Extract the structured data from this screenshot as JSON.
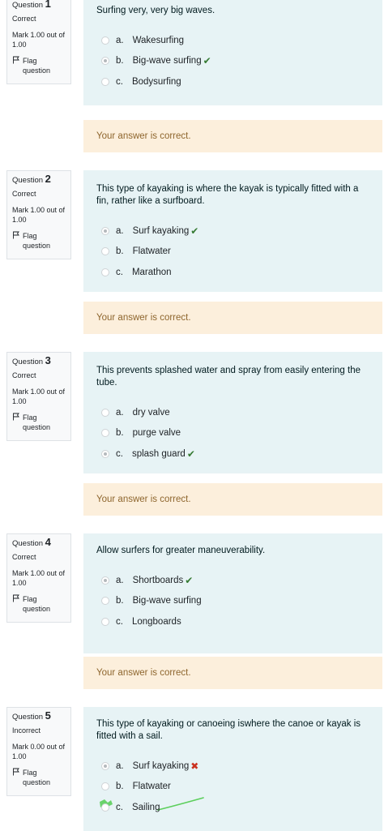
{
  "labels": {
    "question": "Question",
    "flag": "Flag question",
    "flag_line1": "Flag",
    "flag_line2": "question"
  },
  "questions": [
    {
      "number": "1",
      "state": "Correct",
      "mark_line1": "Mark 1.00 out of",
      "mark_line2": "1.00",
      "text": "Surfing very, very big waves.",
      "answers": [
        {
          "letter": "a.",
          "text": "Wakesurfing",
          "selected": false,
          "mark": ""
        },
        {
          "letter": "b.",
          "text": "Big-wave surfing",
          "selected": true,
          "mark": "correct"
        },
        {
          "letter": "c.",
          "text": "Bodysurfing",
          "selected": false,
          "mark": ""
        }
      ],
      "feedback": "Your answer is correct."
    },
    {
      "number": "2",
      "state": "Correct",
      "mark_line1": "Mark 1.00 out of",
      "mark_line2": "1.00",
      "text": "This type of kayaking is where the kayak is typically fitted with a fin, rather like a surfboard.",
      "answers": [
        {
          "letter": "a.",
          "text": "Surf kayaking",
          "selected": true,
          "mark": "correct"
        },
        {
          "letter": "b.",
          "text": "Flatwater",
          "selected": false,
          "mark": ""
        },
        {
          "letter": "c.",
          "text": "Marathon",
          "selected": false,
          "mark": ""
        }
      ],
      "feedback": "Your answer is correct."
    },
    {
      "number": "3",
      "state": "Correct",
      "mark_line1": "Mark 1.00 out of",
      "mark_line2": "1.00",
      "text": "This prevents splashed water and spray from easily entering the tube.",
      "answers": [
        {
          "letter": "a.",
          "text": "dry valve",
          "selected": false,
          "mark": ""
        },
        {
          "letter": "b.",
          "text": "purge valve",
          "selected": false,
          "mark": ""
        },
        {
          "letter": "c.",
          "text": "splash guard",
          "selected": true,
          "mark": "correct"
        }
      ],
      "feedback": "Your answer is correct."
    },
    {
      "number": "4",
      "state": "Correct",
      "mark_line1": "Mark 1.00 out of",
      "mark_line2": "1.00",
      "text": "Allow surfers for greater maneuverability.",
      "answers": [
        {
          "letter": "a.",
          "text": "Shortboards",
          "selected": true,
          "mark": "correct"
        },
        {
          "letter": "b.",
          "text": "Big-wave surfing",
          "selected": false,
          "mark": ""
        },
        {
          "letter": "c.",
          "text": "Longboards",
          "selected": false,
          "mark": ""
        }
      ],
      "feedback": "Your answer is correct."
    },
    {
      "number": "5",
      "state": "Incorrect",
      "mark_line1": "Mark 0.00 out of",
      "mark_line2": "1.00",
      "text": "This type of kayaking or canoeing iswhere the canoe or kayak is fitted with a sail.",
      "answers": [
        {
          "letter": "a.",
          "text": "Surf kayaking",
          "selected": true,
          "mark": "incorrect"
        },
        {
          "letter": "b.",
          "text": "Flatwater",
          "selected": false,
          "mark": ""
        },
        {
          "letter": "c.",
          "text": "Sailing",
          "selected": false,
          "mark": ""
        }
      ],
      "feedback": ""
    }
  ],
  "colors": {
    "correct": "#357a32",
    "incorrect": "#ca3120",
    "question_bg": "#e7f3f5",
    "feedback_bg": "#fcefdc",
    "feedback_text": "#8e662e",
    "annotation": "#5ccf5c"
  }
}
